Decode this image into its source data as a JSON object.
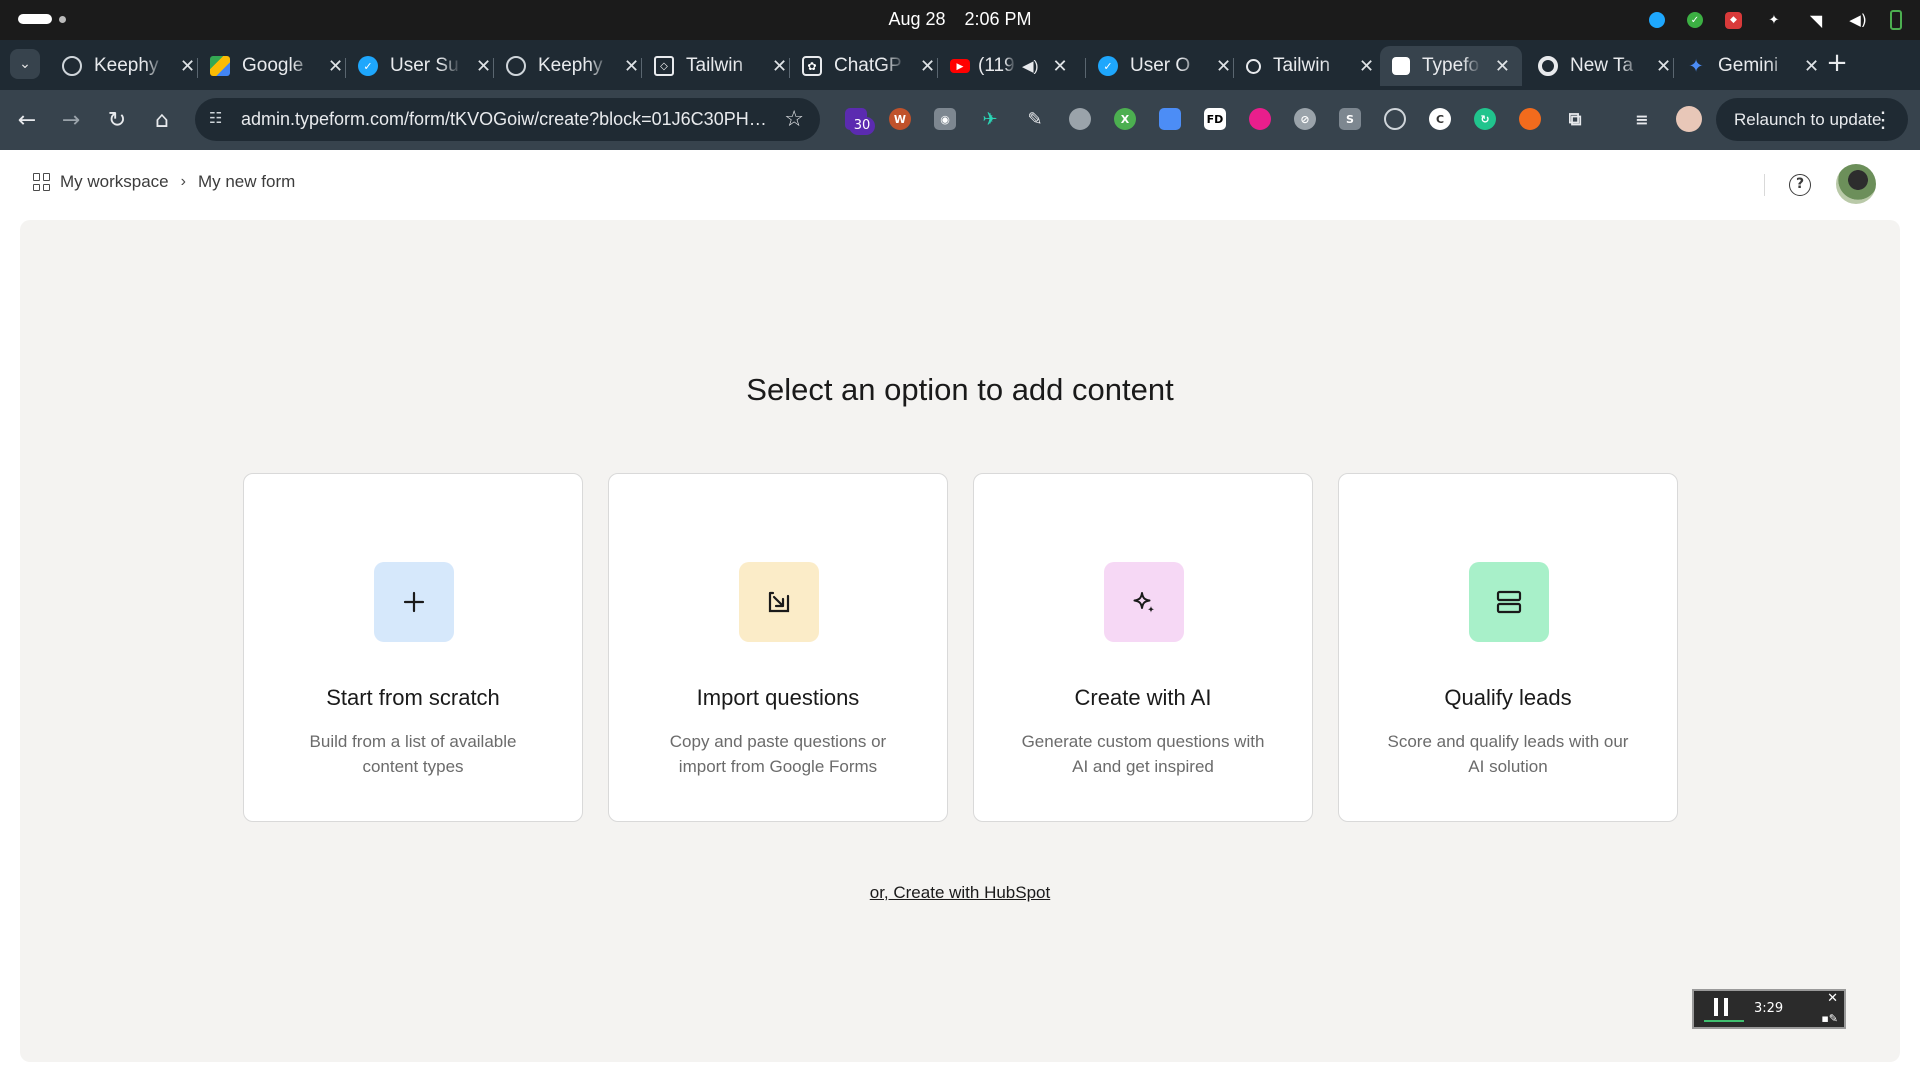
{
  "os": {
    "date": "Aug 28",
    "time": "2:06 PM"
  },
  "tabs": [
    {
      "label": "Keephy",
      "icon": "globe-icon",
      "color": "#cfd5da"
    },
    {
      "label": "Google",
      "icon": "google-drive-icon",
      "color": "#34a853"
    },
    {
      "label": "User Su",
      "icon": "check-circle-icon",
      "color": "#1ea7fd"
    },
    {
      "label": "Keephy",
      "icon": "globe-icon",
      "color": "#cfd5da"
    },
    {
      "label": "Tailwin",
      "icon": "codepen-icon",
      "color": "#e8eaed"
    },
    {
      "label": "ChatGP",
      "icon": "openai-icon",
      "color": "#e8eaed"
    },
    {
      "label": "(119",
      "icon": "youtube-icon",
      "color": "#ff0000"
    },
    {
      "label": "User O",
      "icon": "check-circle-icon",
      "color": "#1ea7fd"
    },
    {
      "label": "Tailwin",
      "icon": "search-icon",
      "color": "#e8eaed"
    },
    {
      "label": "Typefo",
      "icon": "typeform-icon",
      "color": "#ffffff"
    },
    {
      "label": "New Ta",
      "icon": "chrome-icon",
      "color": "#e8eaed"
    },
    {
      "label": "Gemini",
      "icon": "gemini-icon",
      "color": "#4c8df6"
    }
  ],
  "toolbar": {
    "url": "admin.typeform.com/form/tKVOGoiw/create?block=01J6C30PH1...",
    "extension_badge": "30",
    "relaunch_label": "Relaunch to update"
  },
  "header": {
    "workspace_label": "My workspace",
    "form_name": "My new form"
  },
  "main": {
    "headline": "Select an option to add content",
    "options": [
      {
        "title": "Start from scratch",
        "description": "Build from a list of available content types",
        "icon": "plus-icon",
        "accent": "#d6e8fb"
      },
      {
        "title": "Import questions",
        "description": "Copy and paste questions or import from Google Forms",
        "icon": "import-arrow-icon",
        "accent": "#fbecc8"
      },
      {
        "title": "Create with AI",
        "description": "Generate custom questions with AI and get inspired",
        "icon": "sparkle-icon",
        "accent": "#f6d8f5"
      },
      {
        "title": "Qualify leads",
        "description": "Score and qualify leads with our AI solution",
        "icon": "stacked-rows-icon",
        "accent": "#a8f0c9"
      }
    ],
    "hubspot_link": "or, Create with HubSpot"
  },
  "recorder": {
    "elapsed": "3:29"
  }
}
